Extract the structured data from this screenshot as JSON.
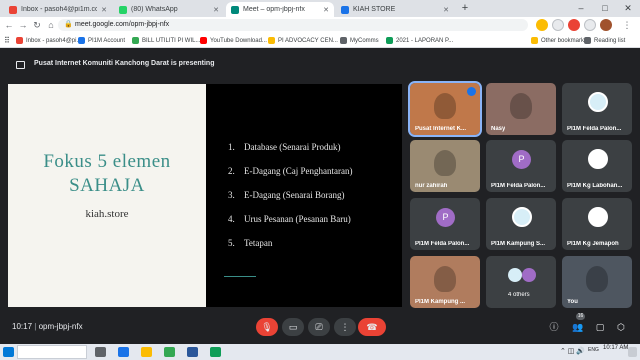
{
  "browser": {
    "tabs": [
      {
        "label": "Inbox - pasoh4@pi1m.com.my",
        "favicon_color": "#ea4335",
        "active": false
      },
      {
        "label": "(80) WhatsApp",
        "favicon_color": "#25d366",
        "active": false
      },
      {
        "label": "Meet – opm-jbpj-nfx",
        "favicon_color": "#00897b",
        "active": true
      },
      {
        "label": "KIAH STORE",
        "favicon_color": "#1a73e8",
        "active": false
      }
    ],
    "new_tab_icon": "plus-icon",
    "url": "meet.google.com/opm-jbpj-nfx",
    "bookmarks": [
      {
        "label": "Inbox - pasoh4@pi...",
        "color": "#ea4335"
      },
      {
        "label": "PI1M Account",
        "color": "#1a73e8"
      },
      {
        "label": "BILL UTILITI PI WIL...",
        "color": "#34a853"
      },
      {
        "label": "YouTube Download...",
        "color": "#ff0000"
      },
      {
        "label": "PI ADVOCACY CEN...",
        "color": "#fbbc04"
      },
      {
        "label": "MyComms",
        "color": "#5f6368"
      },
      {
        "label": "2021 - LAPORAN P...",
        "color": "#0f9d58"
      }
    ],
    "other_bookmarks": "Other bookmarks",
    "reading_list": "Reading list"
  },
  "meeting": {
    "presenting_banner": "Pusat Internet Komuniti Kanchong Darat is presenting",
    "meeting_time": "10:17",
    "meeting_code": "opm-jbpj-nfx",
    "participant_count": "16"
  },
  "slide": {
    "title_line1": "Fokus 5 elemen",
    "title_line2": "SAHAJA",
    "website": "kiah.store",
    "items": [
      {
        "num": "1.",
        "text": "Database (Senarai Produk)"
      },
      {
        "num": "2.",
        "text": "E-Dagang (Caj Penghantaran)"
      },
      {
        "num": "3.",
        "text": "E-Dagang (Senarai Borang)"
      },
      {
        "num": "4.",
        "text": "Urus Pesanan (Pesanan Baru)"
      },
      {
        "num": "5.",
        "text": "Tetapan"
      }
    ]
  },
  "participants": [
    {
      "name": "Pusat Internet K...",
      "kind": "photo",
      "color": "#c0784a",
      "speaking": true
    },
    {
      "name": "Nasy",
      "kind": "photo",
      "color": "#8b6c63",
      "speaking": false
    },
    {
      "name": "PI1M Felda Palon...",
      "kind": "logo",
      "color": "#d7eef7",
      "speaking": false
    },
    {
      "name": "nur zahirah",
      "kind": "photo",
      "color": "#9a8a72",
      "speaking": false
    },
    {
      "name": "PI1M Felda Palon...",
      "kind": "avatar",
      "initial": "P",
      "color": "#a06cc6",
      "speaking": false
    },
    {
      "name": "PI1M Kg Labohan...",
      "kind": "logo",
      "color": "#ffffff",
      "speaking": false
    },
    {
      "name": "PI1M Felda Palon...",
      "kind": "avatar",
      "initial": "P",
      "color": "#a06cc6",
      "speaking": false
    },
    {
      "name": "PI1M Kampung S...",
      "kind": "logo",
      "color": "#d7eef7",
      "speaking": false
    },
    {
      "name": "PI1M Kg Jemapoh",
      "kind": "logo",
      "color": "#ffffff",
      "speaking": false
    },
    {
      "name": "PI1M Kampung ...",
      "kind": "photo",
      "color": "#b07c5e",
      "speaking": false
    },
    {
      "name": "4 others",
      "kind": "others",
      "color": "#3c4043",
      "speaking": false
    },
    {
      "name": "You",
      "kind": "photo",
      "color": "#4e5660",
      "speaking": false
    }
  ],
  "taskbar": {
    "time": "10:17 AM",
    "date": "",
    "language": "ENG"
  }
}
